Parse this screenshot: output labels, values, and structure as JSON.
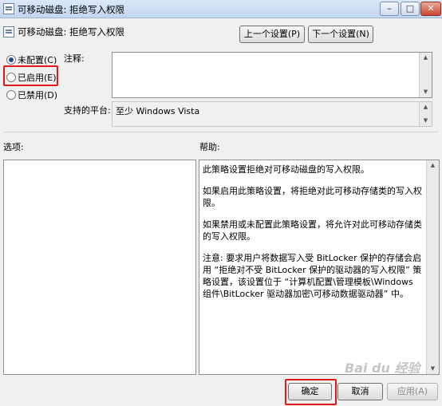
{
  "window": {
    "title": "可移动磁盘: 拒绝写入权限"
  },
  "header": {
    "policy_name": "可移动磁盘: 拒绝写入权限",
    "prev_button": "上一个设置(P)",
    "next_button": "下一个设置(N)"
  },
  "state": {
    "options": [
      "未配置(C)",
      "已启用(E)",
      "已禁用(D)"
    ],
    "selected": "未配置(C)"
  },
  "comment": {
    "label": "注释:",
    "value": ""
  },
  "platform": {
    "label": "支持的平台:",
    "value": "至少 Windows Vista"
  },
  "options_section": {
    "label": "选项:"
  },
  "help_section": {
    "label": "帮助:",
    "paragraphs": [
      "此策略设置拒绝对可移动磁盘的写入权限。",
      "如果启用此策略设置，将拒绝对此可移动存储类的写入权限。",
      "如果禁用或未配置此策略设置，将允许对此可移动存储类的写入权限。",
      "注意: 要求用户将数据写入受 BitLocker 保护的存储会启用 “拒绝对不受 BitLocker 保护的驱动器的写入权限” 策略设置，该设置位于 “计算机配置\\管理模板\\Windows 组件\\BitLocker 驱动器加密\\可移动数据驱动器” 中。"
    ]
  },
  "footer": {
    "ok_button": "确定",
    "cancel_button": "取消",
    "apply_button": "应用(A)"
  },
  "window_controls": {
    "minimize": "–",
    "maximize": "□",
    "close": "✕"
  },
  "watermark": {
    "text": "Bai du 经验"
  },
  "icons": [
    "policy-icon",
    "minimize-icon",
    "maximize-icon",
    "close-icon",
    "scroll-up-icon",
    "scroll-down-icon"
  ]
}
